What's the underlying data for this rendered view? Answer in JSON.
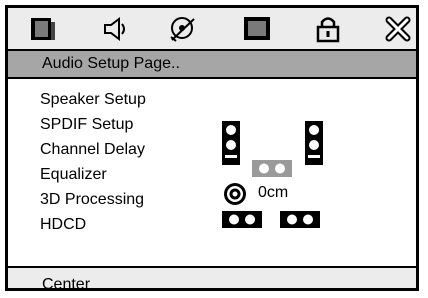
{
  "icons": [
    "general-setup-icon",
    "audio-setup-icon",
    "dolby-digital-icon",
    "video-setup-icon",
    "preference-lock-icon",
    "exit-icon"
  ],
  "page_title": "Audio Setup Page..",
  "menu": {
    "items": [
      "Speaker Setup",
      "SPDIF Setup",
      "Channel Delay",
      "Equalizer",
      "3D Processing",
      "HDCD"
    ]
  },
  "delay_readout": "0cm",
  "status_text": "Center"
}
